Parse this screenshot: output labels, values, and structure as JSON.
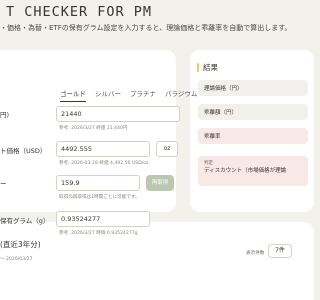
{
  "header": {
    "title": "T CHECKER FOR PM",
    "subtitle": "・価格・為替・ETFの保有グラム設定を入力すると、理論価格と乖離率を自動で算出します。"
  },
  "metal_tabs": [
    "ゴールド",
    "シルバー",
    "プラチナ",
    "パラジウム"
  ],
  "active_tab": "ゴールド",
  "form": {
    "price_row": {
      "label": "円)",
      "value": "21440",
      "hint": "参考: 2026/3/27 終値 21,440円"
    },
    "fx_row": {
      "label": "ト価格（USD）",
      "value": "4492.555",
      "unit": "oz",
      "hint": "参考: 2026-03-28 終値 4,492.56 USD/oz"
    },
    "rate_row": {
      "label": "ー",
      "value": "159.9",
      "button": "再取得",
      "hint": "取得の再取得は1時間ごとに可能です。"
    },
    "gram_row": {
      "label": "保有グラム（g）",
      "value": "0.93524277",
      "hint": "参考: 2026/3/27 時価 0.93524277g"
    }
  },
  "results": {
    "heading": "結果",
    "theoretical": "理論価格（円）",
    "diff_amount": "乖離額（円）",
    "diff_rate": "乖離率",
    "verdict_label": "判定",
    "verdict": "ディスカウント（市場価格が理論"
  },
  "history": {
    "title": "(直近3年分)",
    "date": "〜 2026/03/27",
    "count_label": "表示件数",
    "count_value": "7件"
  },
  "colors": {
    "accent_bar": "#e7c76a",
    "recalc_button": "#bcc7b2",
    "verdict_bg": "#f8e8e6"
  }
}
